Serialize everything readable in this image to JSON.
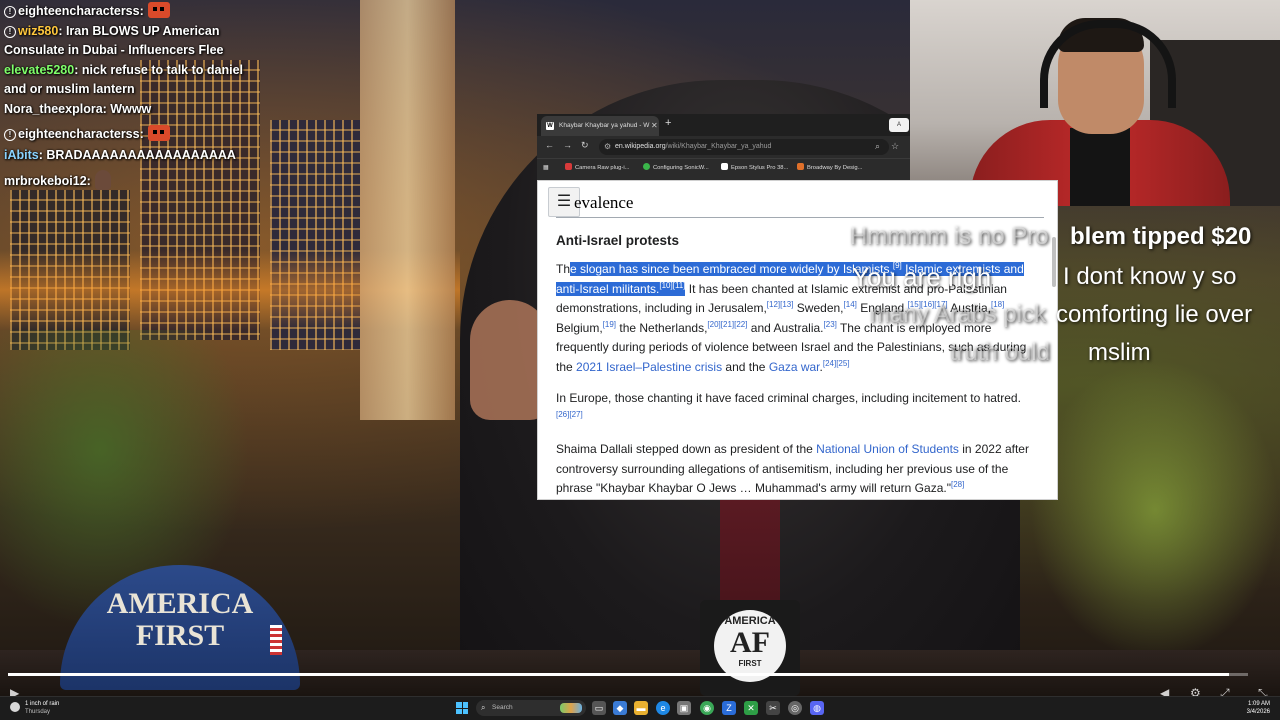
{
  "chat": [
    {
      "user": "eighteencharacterss",
      "badge": true,
      "emote": true,
      "text": ""
    },
    {
      "user": "wiz580",
      "badge": true,
      "text": "Iran BLOWS UP American Consulate in Dubai - Influencers Flee"
    },
    {
      "user": "elevate5280",
      "badge": false,
      "text": "nick refuse to talk to daniel and or muslim lantern"
    },
    {
      "user": "Nora_theexplora",
      "badge": false,
      "text": "Wwww"
    },
    {
      "user": "eighteencharacterss",
      "badge": true,
      "emote": true,
      "text": ""
    },
    {
      "user": "iAbits",
      "badge": false,
      "text": "BRADAAAAAAAAAAAAAAAAA"
    },
    {
      "user": "mrbrokeboi12",
      "badge": false,
      "emote": true,
      "text": ""
    }
  ],
  "browser": {
    "tab_title": "Khaybar Khaybar ya yahud - W",
    "url_domain": "en.wikipedia.org",
    "url_path": "/wiki/Khaybar_Khaybar_ya_yahud",
    "bookmarks": [
      "Camera Raw plug-i...",
      "Configuring SonicW...",
      "Epson Stylus Pro 38...",
      "Broadway By Desig..."
    ]
  },
  "wiki": {
    "section_heading": "evalence",
    "subheading": "Anti-Israel protests",
    "p1": {
      "pre": "Th",
      "sel1": "e slogan has since been embraced more widely by Islamists,",
      "ref9": "[9]",
      "sel2": " Islamic extremists and anti-Israel militants.",
      "ref10": "[10][11]",
      "post1": " It has been chanted at Islamic extremist and pro-Palestinian demonstrations, including in Jerusalem,",
      "ref12": "[12][13]",
      "post2": " Sweden,",
      "ref14": "[14]",
      "post3": " England,",
      "ref15": "[15][16][17]",
      "post4": " Austria,",
      "ref18": "[18]",
      "post5": " Belgium,",
      "ref19": "[19]",
      "post6": " the Netherlands,",
      "ref20": "[20][21][22]",
      "post7": " and Australia.",
      "ref23": "[23]",
      "post8": " The chant is employed more frequently during periods of violence between Israel and the Palestinians, such as during the ",
      "link1": "2021 Israel–Palestine crisis",
      "post9": " and the ",
      "link2": "Gaza war",
      "post10": ".",
      "ref24": "[24][25]"
    },
    "p2": {
      "text": "In Europe, those chanting it have faced criminal charges, including incitement to hatred.",
      "ref": "[26][27]"
    },
    "p3": {
      "pre": "Shaima Dallali stepped down as president of the ",
      "link": "National Union of Students",
      "post": " in 2022 after controversy surrounding allegations of antisemitism, including her previous use of the phrase \"Khaybar Khaybar O Jews … Muhammad's army will return Gaza.\"",
      "ref": "[28]"
    }
  },
  "overlay": {
    "line1_ghost": "Hmmmm is no Pro",
    "line1_bold": "blem tipped $20",
    "line2_white": "You are righ",
    "line2_rest": "I dont know y so",
    "line3_ghost": "many Arabs pick",
    "line3_rest": "comforting lie over",
    "line4_ghost": "truth ould",
    "line4_rest": "mslim"
  },
  "hat": {
    "line1": "AMERICA",
    "line2": "FIRST"
  },
  "mug": {
    "top": "AMERICA",
    "mid": "AF",
    "bottom": "FIRST"
  },
  "video": {
    "progress": 0.985
  },
  "taskbar": {
    "weather_temp": "1 inch of rain",
    "weather_day": "Thursday",
    "search_placeholder": "Search",
    "time": "1:09 AM",
    "date": "3/4/2026"
  }
}
